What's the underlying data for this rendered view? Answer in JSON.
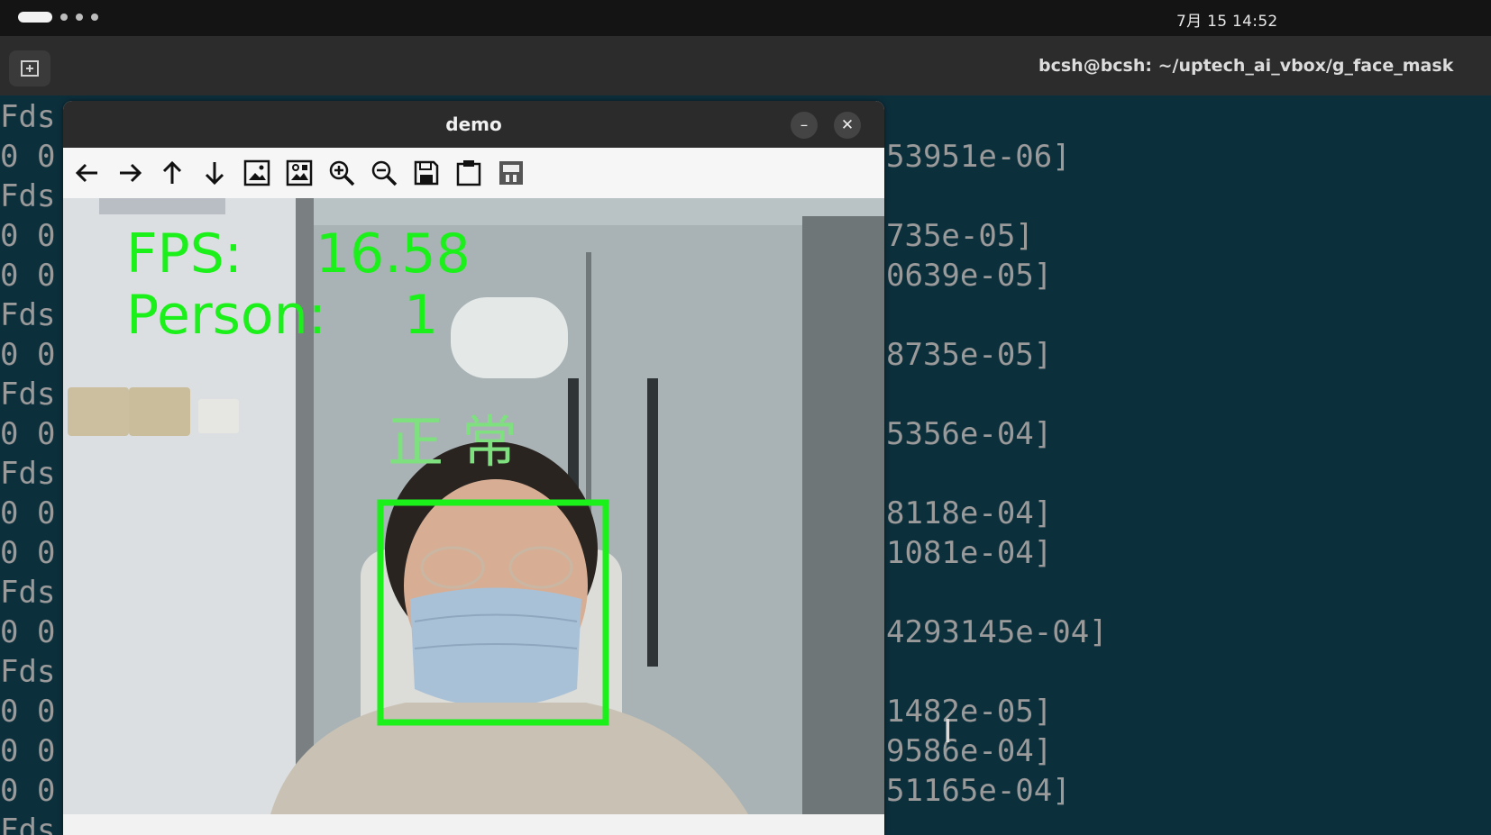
{
  "topbar": {
    "clock": "7月 15  14:52"
  },
  "terminal": {
    "title": "bcsh@bcsh: ~/uptech_ai_vbox/g_face_mask",
    "left_lines": [
      "Fds",
      "0 0",
      "Fds",
      "0 0",
      "0 0",
      "Fds",
      "0 0",
      "Fds",
      "0 0",
      "Fds",
      "0 0",
      "0 0",
      "Fds",
      "0 0",
      "Fds",
      "0 0",
      "0 0",
      "0 0",
      "Fds"
    ],
    "right_lines": [
      {
        "row": 1,
        "text": "53951e-06]"
      },
      {
        "row": 3,
        "text": "735e-05]"
      },
      {
        "row": 4,
        "text": "0639e-05]"
      },
      {
        "row": 6,
        "text": "8735e-05]"
      },
      {
        "row": 8,
        "text": "5356e-04]"
      },
      {
        "row": 10,
        "text": "8118e-04]"
      },
      {
        "row": 11,
        "text": "1081e-04]"
      },
      {
        "row": 13,
        "text": "4293145e-04]"
      },
      {
        "row": 15,
        "text": "1482e-05]"
      },
      {
        "row": 16,
        "text": "9586e-04]"
      },
      {
        "row": 17,
        "text": "51165e-04]"
      }
    ]
  },
  "demo": {
    "title": "demo",
    "minimize": "–",
    "close": "✕",
    "toolbar_icons": [
      "arrow-left-icon",
      "arrow-right-icon",
      "arrow-up-icon",
      "arrow-down-icon",
      "image-icon",
      "image-properties-icon",
      "zoom-in-icon",
      "zoom-out-icon",
      "save-icon",
      "clipboard-icon",
      "settings-icon"
    ],
    "overlay": {
      "fps_label": "FPS:",
      "fps_value": "16.58",
      "person_label": "Person:",
      "person_value": "1",
      "status_label": "正常"
    }
  },
  "colors": {
    "overlay_green": "#1bf01b",
    "terminal_bg": "#0c2f3c",
    "terminal_text": "#9a9a9a"
  }
}
